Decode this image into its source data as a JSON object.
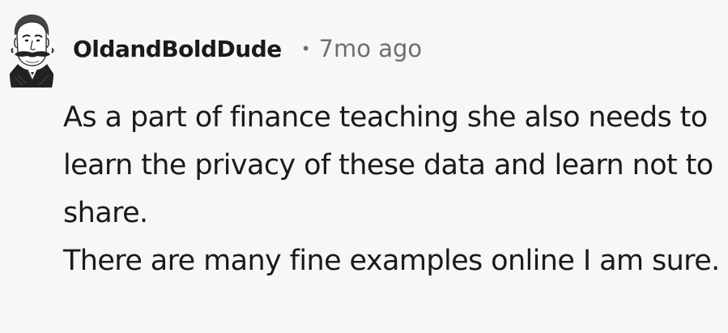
{
  "comment": {
    "author": "OldandBoldDude",
    "separator": "•",
    "timestamp": "7mo ago",
    "paragraphs": [
      "As a part of finance teaching she also needs to learn the privacy of these data and learn not to share.",
      "There are many fine examples online I am sure."
    ]
  },
  "avatar": {
    "icon": "victorian-man-mustache-avatar-icon"
  }
}
